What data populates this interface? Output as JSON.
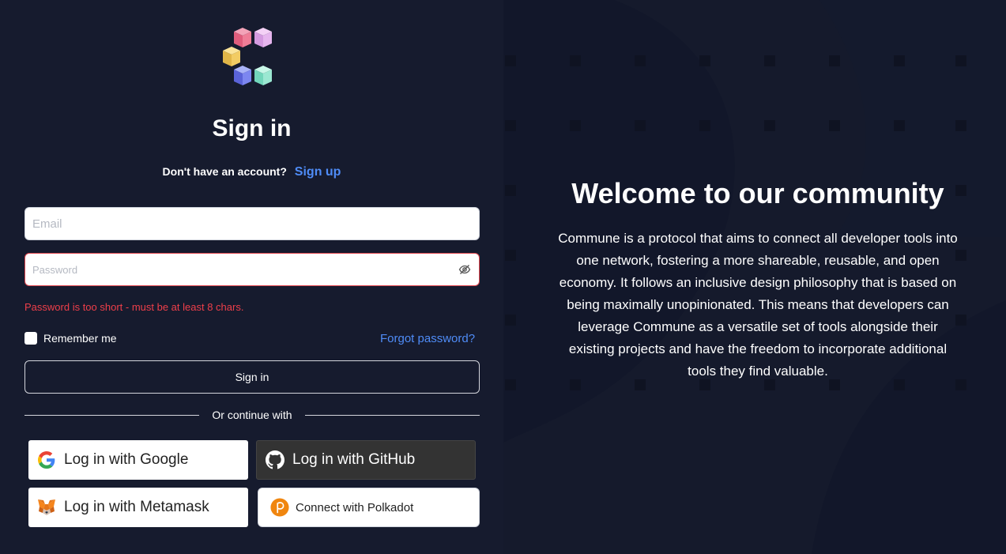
{
  "signin": {
    "title": "Sign in",
    "no_account": "Don't have an account?",
    "signup_link": "Sign up",
    "email_placeholder": "Email",
    "password_placeholder": "Password",
    "password_error": "Password is too short - must be at least 8 chars.",
    "remember_label": "Remember me",
    "forgot_link": "Forgot password?",
    "submit_label": "Sign in",
    "divider_text": "Or continue with"
  },
  "social": {
    "google": "Log in with Google",
    "github": "Log in with GitHub",
    "metamask": "Log in with Metamask",
    "polkadot": "Connect with Polkadot"
  },
  "welcome": {
    "title": "Welcome to our community",
    "description": "Commune is a protocol that aims to connect all developer tools into one network, fostering a more shareable, reusable, and open economy. It follows an inclusive design philosophy that is based on being maximally unopinionated. This means that developers can leverage Commune as a versatile set of tools alongside their existing projects and have the freedom to incorporate additional tools they find valuable."
  },
  "colors": {
    "background": "#161b2e",
    "link": "#4f8cf7",
    "error": "#ef3f4a",
    "github_button": "#333333"
  },
  "icons": {
    "logo": "cubes-logo-icon",
    "password_toggle": "eye-slash-icon",
    "google": "google-icon",
    "github": "github-icon",
    "metamask": "metamask-fox-icon",
    "polkadot": "polkadot-icon"
  }
}
